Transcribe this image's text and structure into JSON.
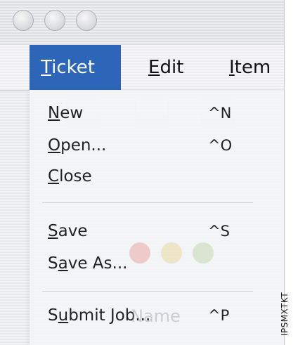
{
  "menubar": {
    "menus": [
      {
        "label": "Ticket",
        "mnemonic": "T",
        "rest": "icket"
      },
      {
        "label": "Edit",
        "mnemonic": "E",
        "rest": "dit"
      },
      {
        "label": "Item",
        "mnemonic": "I",
        "rest": "tem"
      }
    ]
  },
  "ticket_menu": {
    "items": [
      {
        "label": "New",
        "mnemonic": "N",
        "rest": "ew",
        "shortcut": "^N"
      },
      {
        "label": "Open...",
        "mnemonic": "O",
        "rest": "pen...",
        "shortcut": "^O"
      },
      {
        "label": "Close",
        "mnemonic": "C",
        "rest": "lose",
        "shortcut": ""
      },
      {
        "label": "Save",
        "mnemonic": "S",
        "rest": "ave",
        "shortcut": "^S"
      },
      {
        "label": "Save As...",
        "prefix": "S",
        "mnemonic": "a",
        "rest": "ve As...",
        "shortcut": ""
      },
      {
        "label": "Submit Job...",
        "prefix": "S",
        "mnemonic": "u",
        "rest": "bmit Job...",
        "shortcut": "^P"
      }
    ]
  },
  "background": {
    "ghost_field_label": "Name"
  },
  "side_caption": "IPSMXTKT",
  "colors": {
    "menu_highlight": "#2d66b8",
    "traffic_ghost_red": "#e59a95",
    "traffic_ghost_yellow": "#e7d18c",
    "traffic_ghost_green": "#b8d2a1"
  }
}
